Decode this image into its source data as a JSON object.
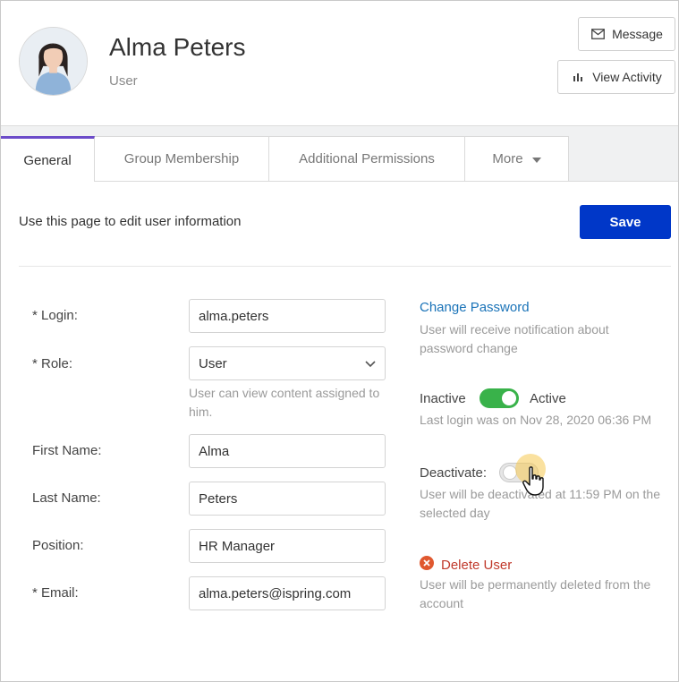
{
  "header": {
    "name": "Alma Peters",
    "role": "User",
    "message_label": "Message",
    "activity_label": "View Activity"
  },
  "tabs": [
    {
      "label": "General",
      "active": true
    },
    {
      "label": "Group Membership",
      "active": false
    },
    {
      "label": "Additional Permissions",
      "active": false
    },
    {
      "label": "More",
      "active": false
    }
  ],
  "intro": "Use this page to edit user information",
  "save_label": "Save",
  "form": {
    "login_label": "* Login:",
    "login_value": "alma.peters",
    "role_label": "* Role:",
    "role_value": "User",
    "role_hint": "User can view content assigned to him.",
    "first_name_label": "First Name:",
    "first_name_value": "Alma",
    "last_name_label": "Last Name:",
    "last_name_value": "Peters",
    "position_label": "Position:",
    "position_value": "HR Manager",
    "email_label": "* Email:",
    "email_value": "alma.peters@ispring.com"
  },
  "side": {
    "change_password": "Change Password",
    "change_password_hint": "User will receive notification about password change",
    "inactive_label": "Inactive",
    "active_label": "Active",
    "active_on": true,
    "last_login": "Last login was on Nov 28, 2020 06:36 PM",
    "deactivate_label": "Deactivate:",
    "deactivate_on": false,
    "deactivate_hint": "User will be deactivated at 11:59 PM on the selected day",
    "delete_label": "Delete User",
    "delete_hint": "User will be permanently deleted from the account"
  },
  "colors": {
    "accent_tab": "#6c4cc9",
    "save_button": "#0037c8",
    "toggle_on": "#39b24a",
    "link": "#1a73b8",
    "danger": "#c0392b"
  },
  "icons": [
    "envelope-icon",
    "bar-chart-icon",
    "caret-down-icon",
    "chevron-down-icon",
    "delete-circle-icon",
    "hand-cursor-icon"
  ]
}
